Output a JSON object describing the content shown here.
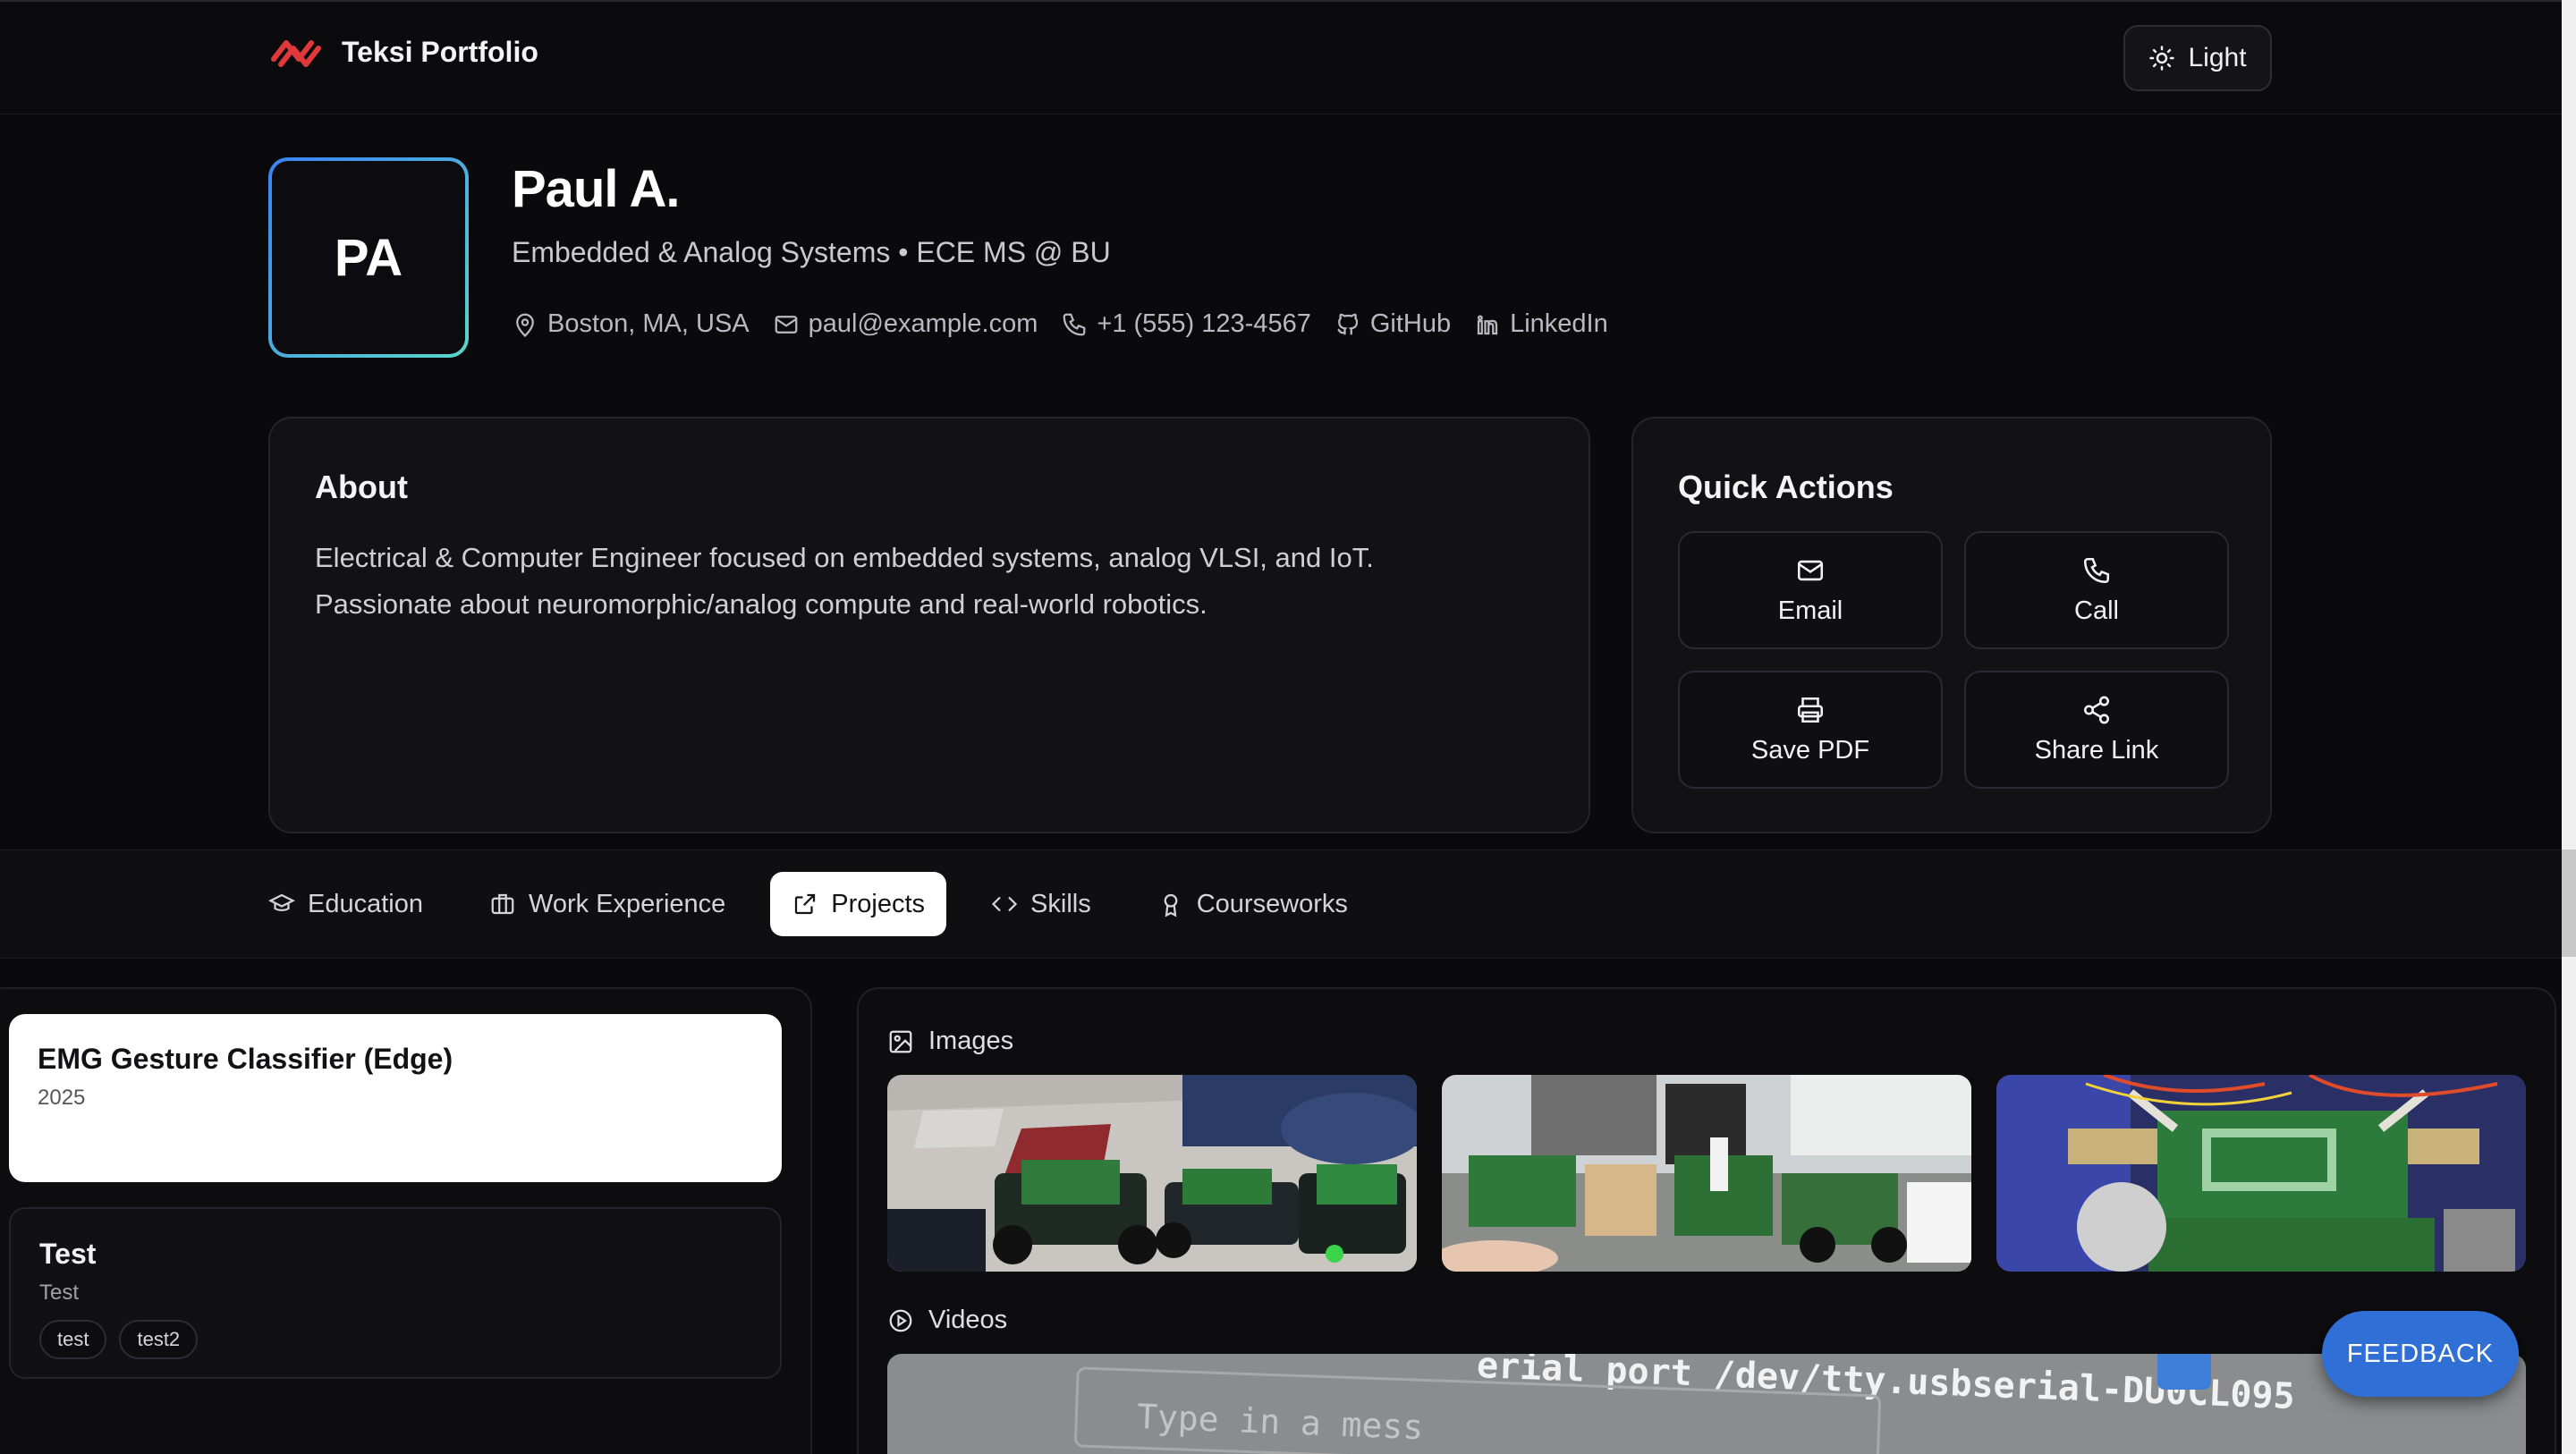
{
  "header": {
    "brand_name": "Teksi Portfolio",
    "theme_label": "Light",
    "accent": "#e0383b"
  },
  "profile": {
    "initials": "PA",
    "name": "Paul A.",
    "tagline": "Embedded & Analog Systems • ECE MS @ BU",
    "location": "Boston, MA, USA",
    "email": "paul@example.com",
    "phone": "+1 (555) 123-4567",
    "github": "GitHub",
    "linkedin": "LinkedIn"
  },
  "about": {
    "title": "About",
    "line1": "Electrical & Computer Engineer focused on embedded systems, analog VLSI, and IoT.",
    "line2": "Passionate about neuromorphic/analog compute and real-world robotics."
  },
  "quick_actions": {
    "title": "Quick Actions",
    "email": "Email",
    "call": "Call",
    "save_pdf": "Save PDF",
    "share_link": "Share Link"
  },
  "tabs": {
    "education": "Education",
    "work": "Work Experience",
    "projects": "Projects",
    "skills": "Skills",
    "courseworks": "Courseworks",
    "active": "Projects"
  },
  "projects": [
    {
      "title": "EMG Gesture Classifier (Edge)",
      "subtitle": "2025",
      "tags": []
    },
    {
      "title": "Test",
      "subtitle": "Test",
      "tags": [
        "test",
        "test2"
      ]
    }
  ],
  "media": {
    "images_label": "Images",
    "videos_label": "Videos",
    "video_line1": "erial port /dev/tty.usbserial-DU0CL095",
    "video_line2": "Type in a mess"
  },
  "feedback_label": "FEEDBACK"
}
